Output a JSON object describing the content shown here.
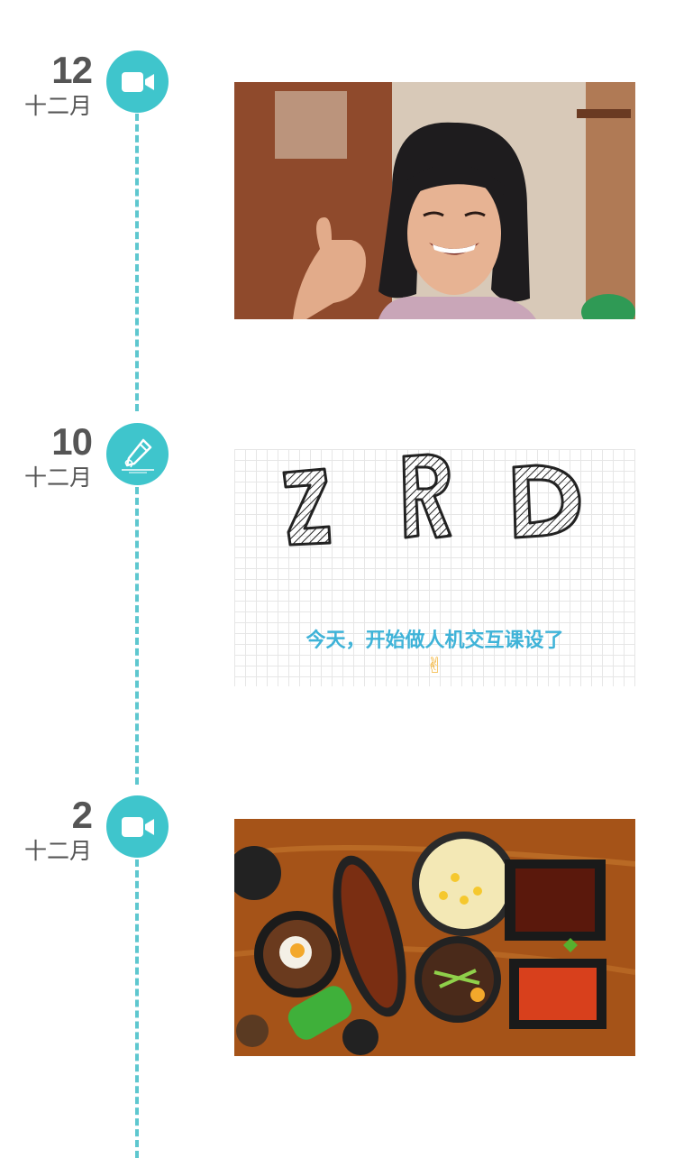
{
  "colors": {
    "accent": "#3fc5cc",
    "line": "#5ec7cf",
    "date_text": "#555555",
    "caption": "#3fb3d8"
  },
  "timeline": [
    {
      "day": "12",
      "month": "十二月",
      "icon": "video-camera-icon",
      "card_type": "photo",
      "photo_subject": "smiling-woman-thumbs-up"
    },
    {
      "day": "10",
      "month": "十二月",
      "icon": "pen-writing-icon",
      "card_type": "text-graphic",
      "letters": [
        "Z",
        "R",
        "D"
      ],
      "caption": "今天，开始做人机交互课设了",
      "emoji": "✌"
    },
    {
      "day": "2",
      "month": "十二月",
      "icon": "video-camera-icon",
      "card_type": "photo",
      "photo_subject": "korean-food-table"
    }
  ]
}
